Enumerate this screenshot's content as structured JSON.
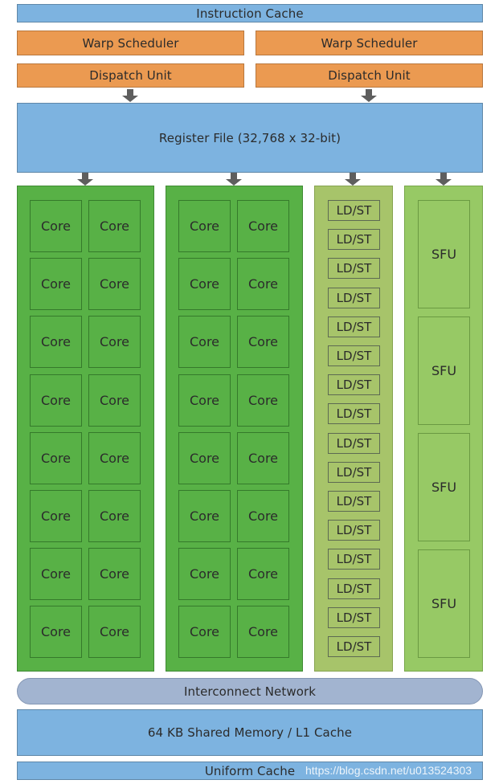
{
  "diagram": {
    "instruction_cache": "Instruction Cache",
    "warp_schedulers": [
      "Warp Scheduler",
      "Warp Scheduler"
    ],
    "dispatch_units": [
      "Dispatch Unit",
      "Dispatch Unit"
    ],
    "register_file": "Register File (32,768 x 32-bit)",
    "core_label": "Core",
    "core_blocks": 2,
    "cores_per_block_rows": 8,
    "cores_per_block_cols": 2,
    "ldst_label": "LD/ST",
    "ldst_count": 16,
    "sfu_label": "SFU",
    "sfu_count": 4,
    "interconnect": "Interconnect Network",
    "shared_memory": "64 KB Shared Memory / L1 Cache",
    "uniform_cache": "Uniform Cache",
    "watermark": "https://blog.csdn.net/u013524303"
  },
  "colors": {
    "cache_blue": "#7db3e0",
    "scheduler_orange": "#eb9a51",
    "core_green": "#58b146",
    "ldst_green": "#a7c46a",
    "sfu_green": "#97c965",
    "interconnect_gray_blue": "#a2b4d0",
    "arrow_gray": "#5e5e5e"
  }
}
